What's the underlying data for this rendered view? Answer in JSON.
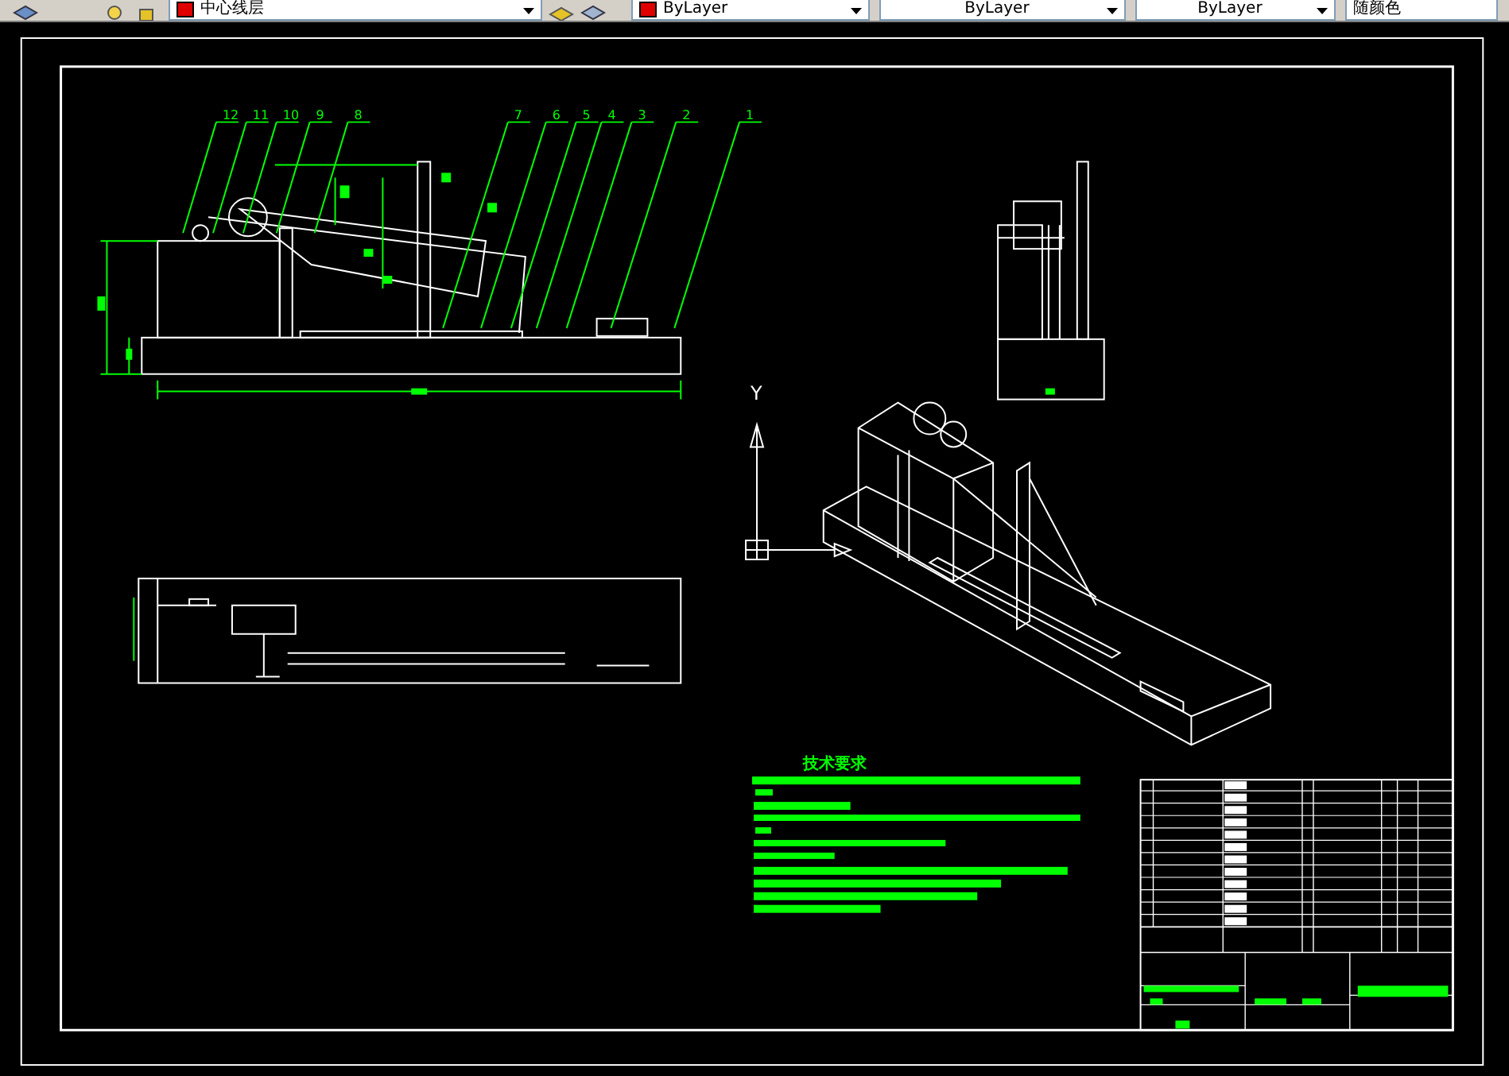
{
  "toolbar": {
    "layer_dropdown": "中心线层",
    "color_dropdown": "ByLayer",
    "linetype_dropdown": "ByLayer",
    "lineweight_dropdown": "ByLayer",
    "plotstyle_dropdown": "随颜色"
  },
  "drawing": {
    "balloons": [
      "12",
      "11",
      "10",
      "9",
      "8",
      "7",
      "6",
      "5",
      "4",
      "3",
      "2",
      "1"
    ],
    "notes_title": "技术要求",
    "ucs_axis": "Y"
  }
}
